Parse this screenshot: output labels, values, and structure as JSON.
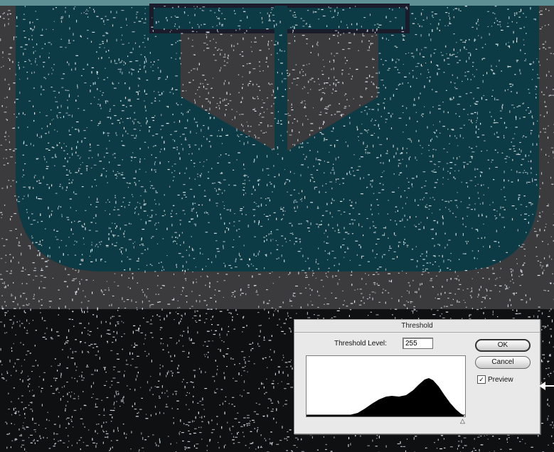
{
  "dialog": {
    "title": "Threshold",
    "threshold_level_label": "Threshold Level:",
    "threshold_level_value": "255",
    "ok_label": "OK",
    "cancel_label": "Cancel",
    "preview_label": "Preview",
    "preview_checked": true,
    "slider_marker_glyph": "△",
    "checkbox_glyph": "✓"
  },
  "colors": {
    "teal_shape": "#0c3a45",
    "gray_background": "#3b3a3c",
    "black_background": "#0f1012",
    "top_band": "#5e8f95",
    "noise": "#e4ecef",
    "dialog_face": "#e9e9e9"
  },
  "icons": {
    "pointer": "arrow-left-icon",
    "preview_check": "checkmark-icon",
    "slider": "triangle-slider-icon"
  }
}
